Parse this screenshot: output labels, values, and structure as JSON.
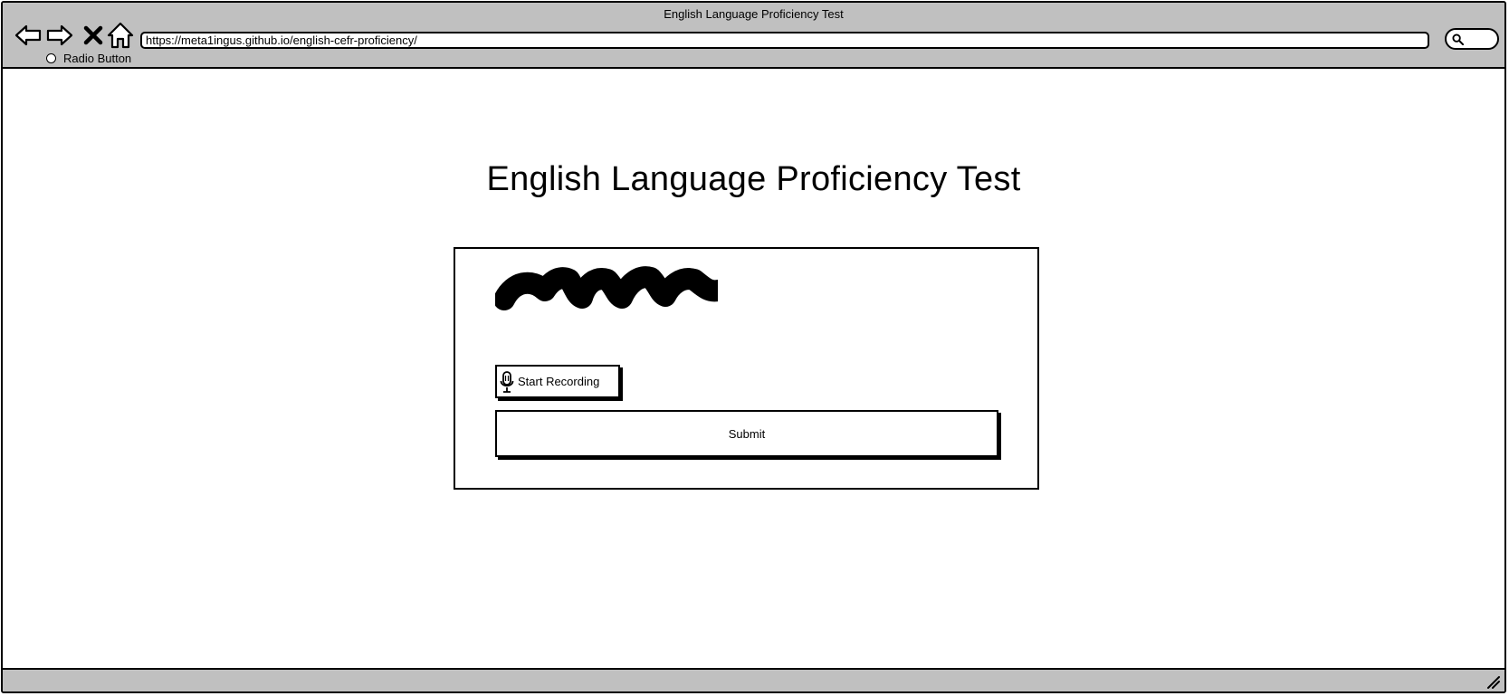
{
  "browser": {
    "window_title": "English Language Proficiency Test",
    "url": "https://meta1ingus.github.io/english-cefr-proficiency/",
    "radio_label": "Radio Button",
    "nav_icons": [
      "back-arrow-icon",
      "forward-arrow-icon",
      "close-icon",
      "home-icon"
    ],
    "search_icon": "search-icon",
    "chrome_color": "#c0c0c0"
  },
  "page": {
    "title": "English Language Proficiency Test",
    "placeholder_graphic": "scribble",
    "record_button_label": "Start Recording",
    "record_icon": "microphone-icon",
    "submit_label": "Submit"
  }
}
